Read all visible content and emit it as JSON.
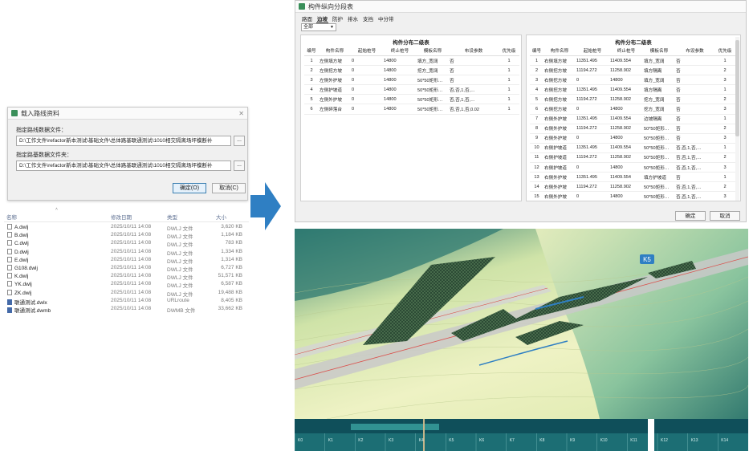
{
  "load_dialog": {
    "title": "载入路线资料",
    "route_file_label": "指定路线数据文件：",
    "route_file_path": "D:\\工作文件\\refactor新本测试\\基础文件\\总体路基联通测试\\1010相交隔离场坪模断补",
    "subgrade_folder_label": "指定路基数据文件夹：",
    "subgrade_folder_path": "D:\\工作文件\\refactor新本测试\\基础文件\\总体路基联通测试\\1010相交隔离场坪模断补",
    "browse": "...",
    "ok": "确定(O)",
    "cancel": "取消(C)"
  },
  "file_list": {
    "headers": {
      "name": "名称",
      "modified": "修改日期",
      "type": "类型",
      "size": "大小"
    },
    "rows": [
      {
        "name": "A.dwlj",
        "modified": "2025/10/11 14:08",
        "type": "DWLJ 文件",
        "size": "3,620 KB"
      },
      {
        "name": "B.dwlj",
        "modified": "2025/10/11 14:08",
        "type": "DWLJ 文件",
        "size": "1,184 KB"
      },
      {
        "name": "C.dwlj",
        "modified": "2025/10/11 14:08",
        "type": "DWLJ 文件",
        "size": "783 KB"
      },
      {
        "name": "D.dwlj",
        "modified": "2025/10/11 14:08",
        "type": "DWLJ 文件",
        "size": "1,334 KB"
      },
      {
        "name": "E.dwlj",
        "modified": "2025/10/11 14:08",
        "type": "DWLJ 文件",
        "size": "1,314 KB"
      },
      {
        "name": "G108.dwlj",
        "modified": "2025/10/11 14:08",
        "type": "DWLJ 文件",
        "size": "6,727 KB"
      },
      {
        "name": "K.dwlj",
        "modified": "2025/10/11 14:08",
        "type": "DWLJ 文件",
        "size": "51,571 KB"
      },
      {
        "name": "YK.dwlj",
        "modified": "2025/10/11 14:08",
        "type": "DWLJ 文件",
        "size": "6,587 KB"
      },
      {
        "name": "ZK.dwlj",
        "modified": "2025/10/11 14:08",
        "type": "DWLJ 文件",
        "size": "19,488 KB"
      },
      {
        "name": "联通测试.dwlx",
        "modified": "2025/10/11 14:08",
        "type": "URLroute",
        "size": "8,405 KB"
      },
      {
        "name": "联通测试.dwmb",
        "modified": "2025/10/11 14:08",
        "type": "DWMB 文件",
        "size": "33,662 KB"
      }
    ]
  },
  "table_window": {
    "title": "构件纵向分段表",
    "tabs": [
      "路面",
      "边坡",
      "防护",
      "排水",
      "支挡",
      "中分带"
    ],
    "active_tab": "边坡",
    "filter_value": "全部",
    "ok": "确定",
    "cancel": "取消",
    "left_table": {
      "title": "构件分布二级表",
      "headers": [
        "编号",
        "构件名称",
        "起始桩号",
        "终止桩号",
        "模板名称",
        "布设参数",
        "优先级"
      ],
      "rows": [
        [
          "1",
          "左侧填方坡",
          "0",
          "14800",
          "填方_宽阔",
          "否",
          "1"
        ],
        [
          "2",
          "左侧挖方坡",
          "0",
          "14800",
          "挖方_宽阔",
          "否",
          "1"
        ],
        [
          "3",
          "左侧外护坡",
          "0",
          "14800",
          "50*50矩形…",
          "否",
          "1"
        ],
        [
          "4",
          "左侧护坡道",
          "0",
          "14800",
          "50*50矩形…",
          "否,否,1,否,…",
          "1"
        ],
        [
          "5",
          "左侧外护坡",
          "0",
          "14800",
          "50*50矩形…",
          "否,否,1,否,…",
          "1"
        ],
        [
          "6",
          "左侧碎落台",
          "0",
          "14800",
          "50*50矩形…",
          "否,否,1,否,0.02",
          "1"
        ]
      ]
    },
    "right_table": {
      "title": "构件分布二级表",
      "headers": [
        "编号",
        "构件名称",
        "起始桩号",
        "终止桩号",
        "模板名称",
        "布设参数",
        "优先级"
      ],
      "rows": [
        [
          "1",
          "右侧填方坡",
          "11351.495",
          "11409.554",
          "填方_宽阔",
          "否",
          "1"
        ],
        [
          "2",
          "右侧挖方坡",
          "11194.272",
          "11258.902",
          "填方隔离",
          "否",
          "2"
        ],
        [
          "3",
          "右侧挖方坡",
          "0",
          "14800",
          "填方_宽阔",
          "否",
          "3"
        ],
        [
          "4",
          "右侧挖方坡",
          "11351.495",
          "11409.554",
          "填方隔离",
          "否",
          "1"
        ],
        [
          "5",
          "右侧挖方坡",
          "11194.272",
          "11258.902",
          "挖方_宽阔",
          "否",
          "2"
        ],
        [
          "6",
          "右侧挖方坡",
          "0",
          "14800",
          "挖方_宽阔",
          "否",
          "3"
        ],
        [
          "7",
          "右侧外护坡",
          "11351.495",
          "11409.554",
          "边坡隔离",
          "否",
          "1"
        ],
        [
          "8",
          "右侧外护坡",
          "11194.272",
          "11258.902",
          "50*50矩形…",
          "否",
          "2"
        ],
        [
          "9",
          "右侧外护坡",
          "0",
          "14800",
          "50*50矩形…",
          "否",
          "3"
        ],
        [
          "10",
          "右侧护坡道",
          "11351.495",
          "11409.554",
          "50*50矩形…",
          "否,否,1,否,…",
          "1"
        ],
        [
          "11",
          "右侧护坡道",
          "11194.272",
          "11258.902",
          "50*50矩形…",
          "否,否,1,否,…",
          "2"
        ],
        [
          "12",
          "右侧护坡道",
          "0",
          "14800",
          "50*50矩形…",
          "否,否,1,否,…",
          "3"
        ],
        [
          "13",
          "右侧外护坡",
          "11351.495",
          "11409.554",
          "填方护坡道",
          "否",
          "1"
        ],
        [
          "14",
          "右侧外护坡",
          "11194.272",
          "11258.902",
          "50*50矩形…",
          "否,否,1,否,…",
          "2"
        ],
        [
          "15",
          "右侧外护坡",
          "0",
          "14800",
          "50*50矩形…",
          "否,否,1,否,…",
          "3"
        ],
        [
          "16",
          "右侧碎落台",
          "11351.495",
          "11409.554",
          "50*50矩形…",
          "否,否,1,否,0.02",
          "1"
        ],
        [
          "17",
          "右侧碎落台",
          "11194.272",
          "11258.902",
          "50*50矩形…",
          "否,否,1,否,0.02",
          "2"
        ]
      ]
    }
  },
  "view3d": {
    "station_badge": "K5",
    "colors": {
      "terrain_light": "#eef2c4",
      "terrain_dark": "#1f6d68",
      "slope_mesh": "#2c4a35",
      "road": "#c9c9c9",
      "centerline": "#d9534f",
      "badge": "#2f7fc3"
    }
  },
  "timeline": {
    "labels": [
      "K0",
      "K1",
      "K2",
      "K3",
      "K4",
      "K5",
      "K6",
      "K7",
      "K8",
      "K9",
      "K10",
      "K11",
      "K12",
      "K13",
      "K14"
    ]
  }
}
